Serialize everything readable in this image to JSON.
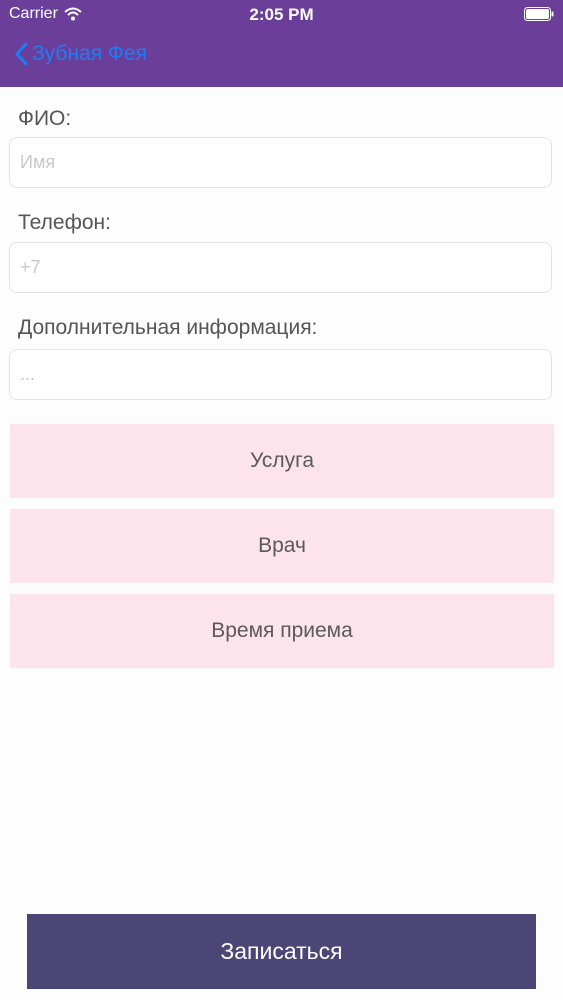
{
  "status_bar": {
    "carrier": "Carrier",
    "time": "2:05 PM"
  },
  "nav": {
    "back_label": "Зубная Фея"
  },
  "form": {
    "name_label": "ФИО:",
    "name_placeholder": "Имя",
    "phone_label": "Телефон:",
    "phone_placeholder": "+7",
    "info_label": "Дополнительная информация:",
    "info_placeholder": "..."
  },
  "buttons": {
    "service": "Услуга",
    "doctor": "Врач",
    "time": "Время приема",
    "submit": "Записаться"
  },
  "colors": {
    "header": "#6b3f99",
    "back_link": "#1e7cf5",
    "selector_bg": "#fde3ec",
    "submit_bg": "#4c4677"
  }
}
